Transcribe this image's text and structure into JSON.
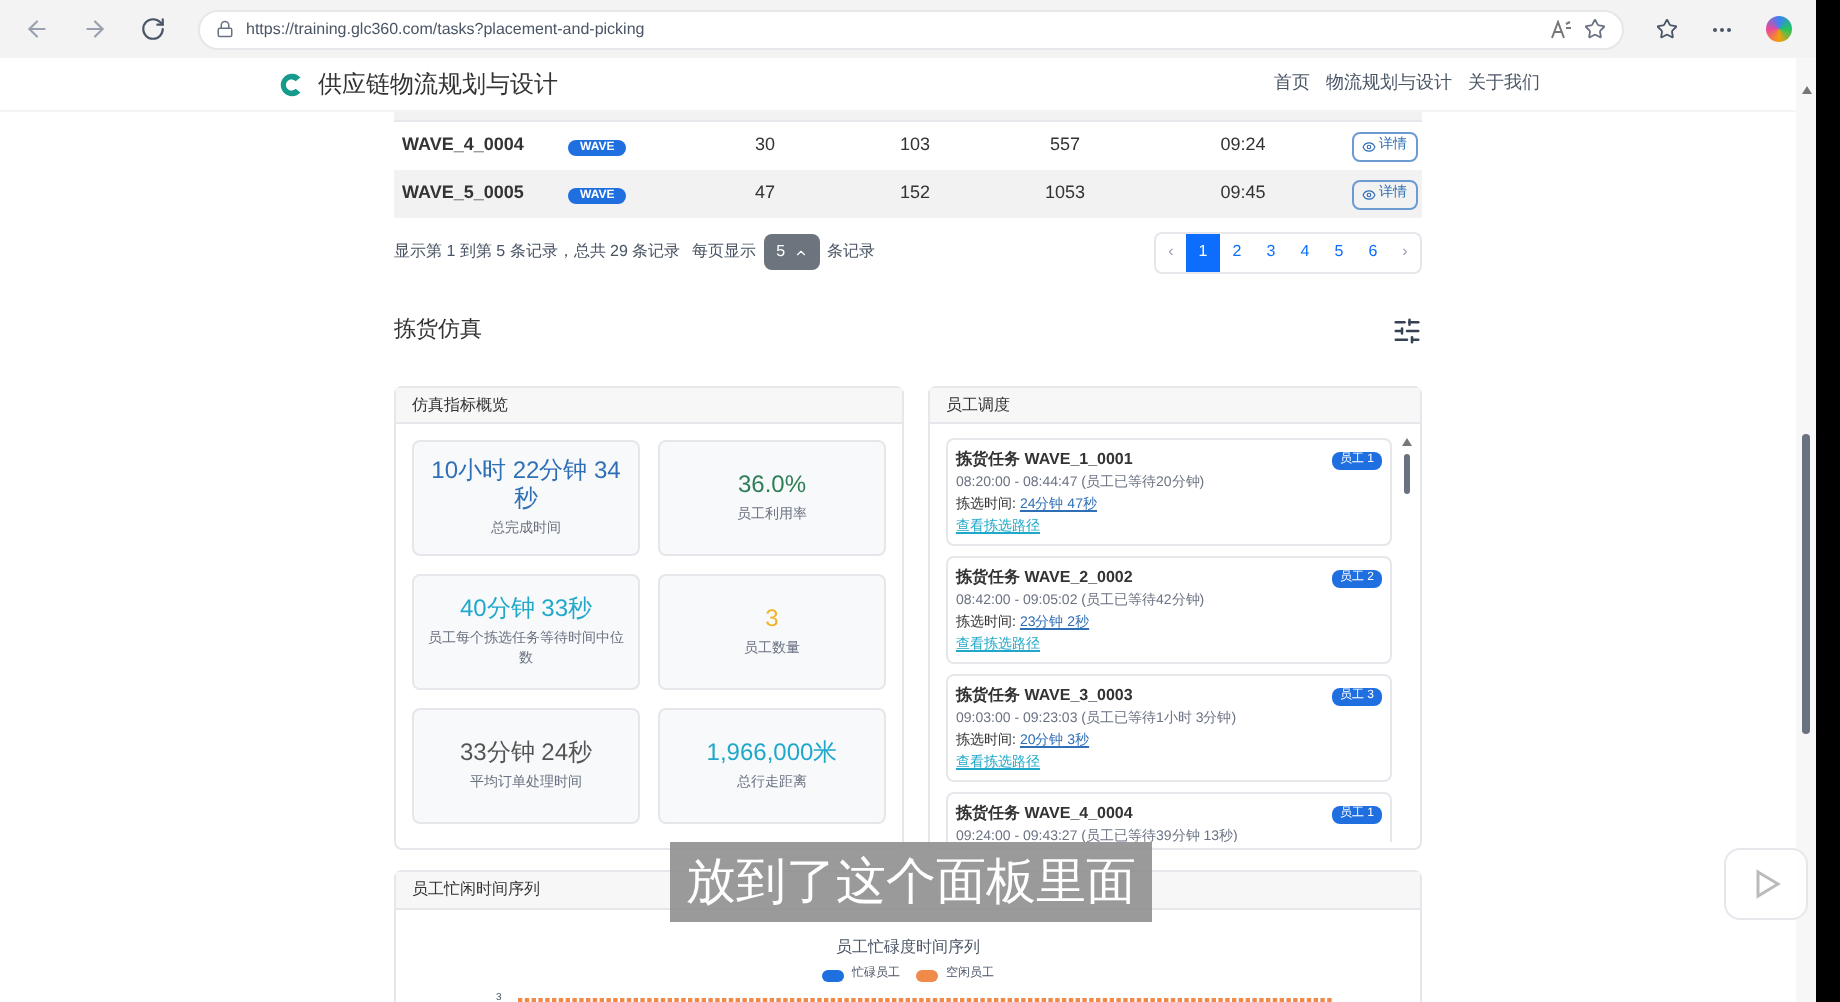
{
  "browser": {
    "url": "https://training.glc360.com/tasks?placement-and-picking"
  },
  "header": {
    "brand": "供应链物流规划与设计",
    "nav": [
      {
        "label": "首页",
        "selected": false
      },
      {
        "label": "物流规划与设计",
        "selected": false
      },
      {
        "label": "关于我们",
        "selected": false
      }
    ]
  },
  "table": {
    "rows": [
      {
        "id": "WAVE_4_0004",
        "tag": "WAVE",
        "column_3": "30",
        "column_4": "103",
        "column_5": "557",
        "column_6": "09:24",
        "action": "详情"
      },
      {
        "id": "WAVE_5_0005",
        "tag": "WAVE",
        "column_3": "47",
        "column_4": "152",
        "column_5": "1053",
        "column_6": "09:45",
        "action": "详情"
      }
    ]
  },
  "pagination": {
    "summary": "显示第 1 到第 5 条记录，总共 29 条记录",
    "per_page_label": "每页显示",
    "per_page": "5",
    "per_page_suffix": "条记录",
    "prev": "‹",
    "next": "›",
    "pages": [
      {
        "label": "1",
        "selected": true
      },
      {
        "label": "2",
        "selected": false
      },
      {
        "label": "3",
        "selected": false
      },
      {
        "label": "4",
        "selected": false
      },
      {
        "label": "5",
        "selected": false
      },
      {
        "label": "6",
        "selected": false
      }
    ]
  },
  "section_title": "拣货仿真",
  "metrics_panel": {
    "title": "仿真指标概览",
    "metrics": [
      {
        "value": "10小时 22分钟 34秒",
        "label": "总完成时间",
        "color": "#2f6fb5"
      },
      {
        "value": "36.0%",
        "label": "员工利用率",
        "color": "#2e7d55"
      },
      {
        "value": "40分钟 33秒",
        "label": "员工每个拣选任务等待时间中位数",
        "color": "#1fa8c9"
      },
      {
        "value": "3",
        "label": "员工数量",
        "color": "#f0b429"
      },
      {
        "value": "33分钟 24秒",
        "label": "平均订单处理时间",
        "color": "#555555"
      },
      {
        "value": "1,966,000米",
        "label": "总行走距离",
        "color": "#1fa8c9"
      }
    ]
  },
  "schedule_panel": {
    "title": "员工调度",
    "tasks": [
      {
        "title": "拣货任务 WAVE_1_0001",
        "worker": "员工 1",
        "time": "08:20:00 - 08:44:47 (员工已等待20分钟)",
        "pick_label": "拣选时间:",
        "pick_time": "24分钟 47秒",
        "route": "查看拣选路径"
      },
      {
        "title": "拣货任务 WAVE_2_0002",
        "worker": "员工 2",
        "time": "08:42:00 - 09:05:02 (员工已等待42分钟)",
        "pick_label": "拣选时间:",
        "pick_time": "23分钟 2秒",
        "route": "查看拣选路径"
      },
      {
        "title": "拣货任务 WAVE_3_0003",
        "worker": "员工 3",
        "time": "09:03:00 - 09:23:03 (员工已等待1小时 3分钟)",
        "pick_label": "拣选时间:",
        "pick_time": "20分钟 3秒",
        "route": "查看拣选路径"
      },
      {
        "title": "拣货任务 WAVE_4_0004",
        "worker": "员工 1",
        "time": "09:24:00 - 09:43:27 (员工已等待39分钟 13秒)"
      }
    ]
  },
  "timeline_panel": {
    "title": "员工忙闲时间序列",
    "chart_title": "员工忙碌度时间序列",
    "legend": [
      {
        "label": "忙碌员工",
        "color": "#1f6fe0"
      },
      {
        "label": "空闲员工",
        "color": "#f08a4b"
      }
    ],
    "y_tick": "3"
  },
  "video_caption": "放到了这个面板里面"
}
